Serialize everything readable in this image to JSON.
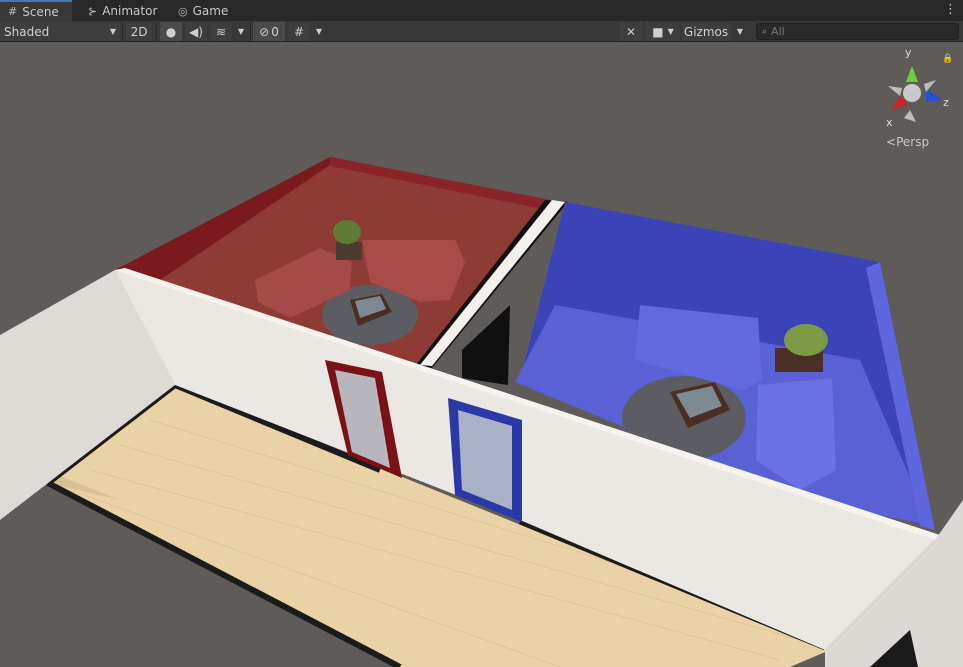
{
  "tabs": [
    {
      "label": "Scene",
      "icon": "grid-icon",
      "active": true
    },
    {
      "label": "Animator",
      "icon": "animator-icon",
      "active": false
    },
    {
      "label": "Game",
      "icon": "gamepad-icon",
      "active": false
    }
  ],
  "toolbar": {
    "draw_mode": "Shaded",
    "mode_2d": "2D",
    "hidden_count": "0",
    "gizmos_label": "Gizmos",
    "search_placeholder": "All"
  },
  "gizmo": {
    "axis_y": "y",
    "axis_x": "x",
    "axis_z": "z",
    "projection": "Persp"
  },
  "colors": {
    "red_room_wall": "#7a1a1c",
    "red_room_floor": "#8e3a35",
    "blue_room_wall": "#3b43b8",
    "blue_room_floor": "#5a61d4",
    "hall_floor": "#e9d3a6",
    "wall_white": "#e8e4e0",
    "viewport_bg": "#5e5b58",
    "active_tab_accent": "#3a79bb"
  }
}
